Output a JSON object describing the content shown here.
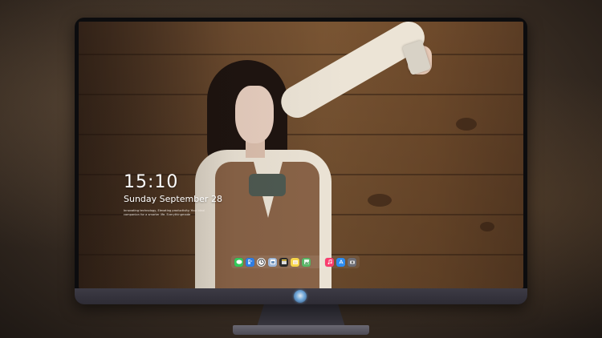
{
  "lockscreen": {
    "time": "15:10",
    "date": "Sunday September 28",
    "tagline": "Innovating technology, Elevating productivity. Your ideal companion for a smarter life. Everythingmade"
  },
  "dock": {
    "apps": [
      {
        "icon": "messages-icon",
        "color": "#34c759"
      },
      {
        "icon": "finder-icon",
        "color": "#2f7de1"
      },
      {
        "icon": "clock-icon",
        "color": "#f2f2f2"
      },
      {
        "icon": "preview-icon",
        "color": "#9fb8d8"
      },
      {
        "icon": "clapper-icon",
        "color": "#2a2a2a"
      },
      {
        "icon": "notes-icon",
        "color": "#f5d44a"
      },
      {
        "icon": "photos-icon",
        "color": "#58b866"
      },
      {
        "icon": "music-icon",
        "color": "#fa3d6e"
      },
      {
        "icon": "app-store-icon",
        "color": "#2d8cf0"
      },
      {
        "icon": "camera-icon",
        "color": "#6e6e76"
      }
    ]
  },
  "device": {
    "logo": "monitor-logo-icon"
  }
}
